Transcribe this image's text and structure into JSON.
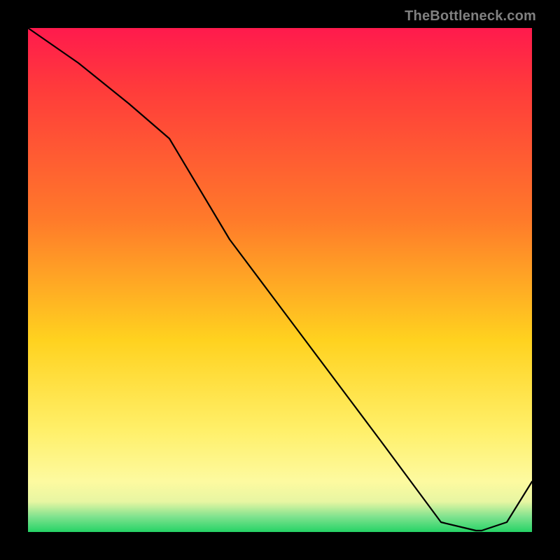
{
  "watermark": "TheBottleneck.com",
  "bottom_label": "",
  "colors": {
    "gradient_top": "#ff1a4d",
    "gradient_mid1": "#ff7a2a",
    "gradient_mid2": "#ffd21f",
    "gradient_bottom": "#25d366",
    "curve": "#000000",
    "frame": "#000000"
  },
  "chart_data": {
    "type": "line",
    "title": "",
    "xlabel": "",
    "ylabel": "",
    "xlim": [
      0,
      100
    ],
    "ylim": [
      0,
      100
    ],
    "series": [
      {
        "name": "curve",
        "x": [
          0,
          10,
          20,
          28,
          40,
          55,
          70,
          82,
          90,
          95,
          100
        ],
        "y": [
          100,
          93,
          85,
          78,
          58,
          38,
          18,
          2,
          0,
          2,
          10
        ]
      }
    ],
    "notes": "y-axis inverted visually: higher y plots nearer top; valley near x≈88 touches y≈0 (green band)."
  }
}
